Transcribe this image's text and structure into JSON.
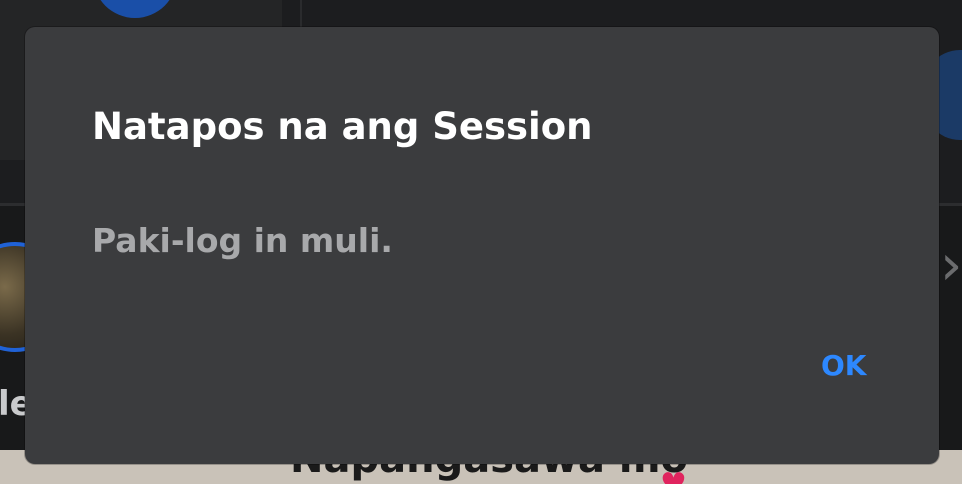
{
  "dialog": {
    "title": "Natapos na ang Session",
    "message": "Paki-log in muli.",
    "ok_label": "OK"
  },
  "background": {
    "left_text_fragment": "le",
    "bottom_text_fragment": "Napangasawa mo",
    "chevron_icon": "chevron-right-icon",
    "heart_icon": "heart-icon"
  },
  "colors": {
    "dialog_background": "#3b3c3e",
    "title_text": "#ffffff",
    "message_text": "#a8a9ab",
    "accent": "#2d88ff"
  }
}
